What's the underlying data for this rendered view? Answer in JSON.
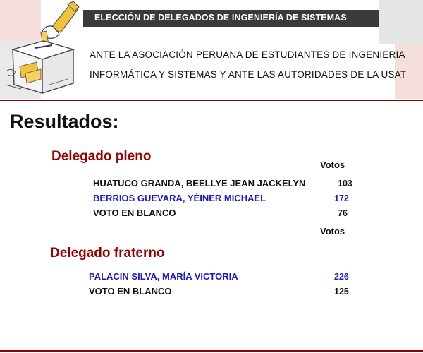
{
  "header": {
    "title": "ELECCIÓN DE DELEGADOS DE INGENIERÍA DE SISTEMAS",
    "subtitle_line1": "ANTE LA ASOCIACIÓN PERUANA DE ESTUDIANTES DE INGENIERIA",
    "subtitle_line2": "INFORMÁTICA Y SISTEMAS Y ANTE LAS AUTORIDADES DE LA USAT"
  },
  "results_heading": "Resultados:",
  "sections": [
    {
      "title": "Delegado pleno",
      "votes_header": "Votos",
      "rows": [
        {
          "name": "HUATUCO GRANDA, BEELLYE JEAN JACKELYN",
          "votes": "103",
          "color": "#111111"
        },
        {
          "name": "BERRIOS GUEVARA, YÉINER MICHAEL",
          "votes": "172",
          "color": "#1a1acc"
        },
        {
          "name": "VOTO EN BLANCO",
          "votes": "76",
          "color": "#111111"
        }
      ]
    },
    {
      "title": "Delegado fraterno",
      "votes_header": "Votos",
      "rows": [
        {
          "name": "PALACIN SILVA, MARÍA VICTORIA",
          "votes": "226",
          "color": "#1a1acc"
        },
        {
          "name": "VOTO EN BLANCO",
          "votes": "125",
          "color": "#111111"
        }
      ]
    }
  ],
  "colors": {
    "accent_red": "#990000",
    "divider": "#8b0000",
    "title_bar": "#3a3a3a",
    "link_blue": "#1a1acc",
    "deco_pink": "#f5dede",
    "deco_gray": "#e6e6e6"
  },
  "icons": [
    "ballot-box-icon"
  ]
}
